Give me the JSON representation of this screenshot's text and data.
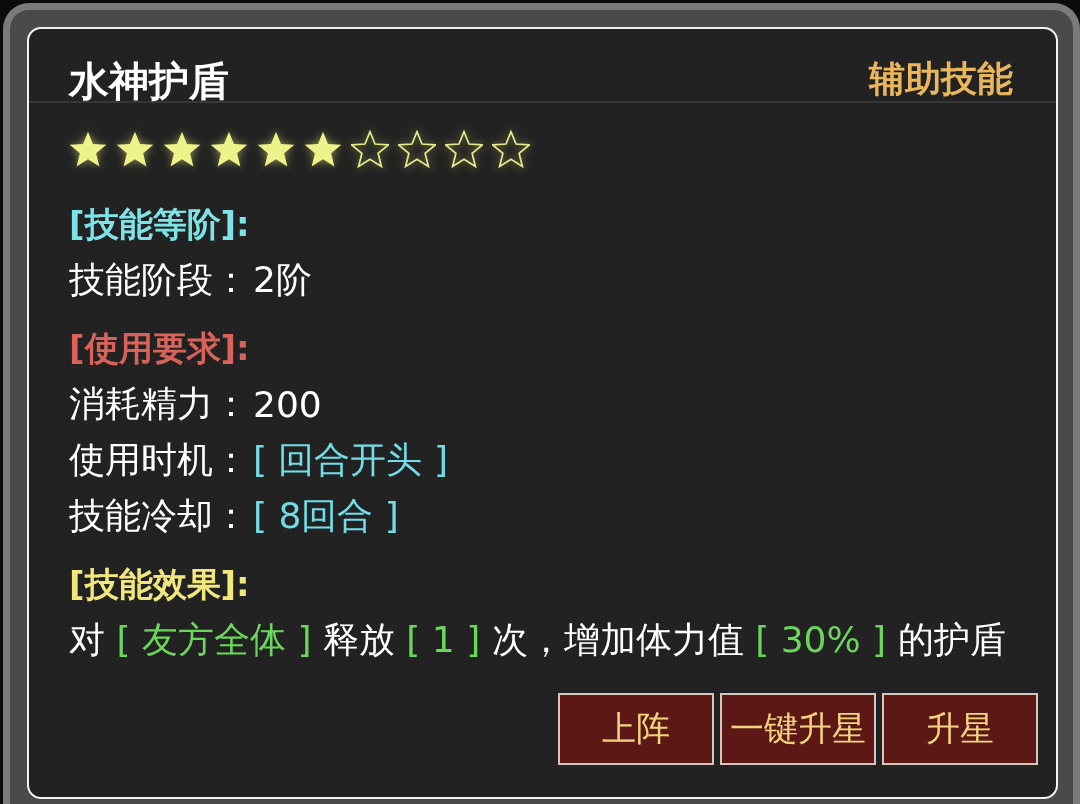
{
  "skill": {
    "name": "水神护盾",
    "category": "辅助技能",
    "stars": 6
  },
  "sections": [
    {
      "heading": "[技能等阶]:",
      "color": "#7ee3e6",
      "rows": [
        {
          "kind": "pair",
          "label": "技能阶段：",
          "value": "2阶",
          "color": "#ffffff"
        }
      ]
    },
    {
      "heading": "[使用要求]:",
      "color": "#d9635b",
      "rows": [
        {
          "kind": "pair",
          "label": "消耗精力：",
          "value": "200",
          "color": "#ffffff"
        },
        {
          "kind": "pair",
          "label": "使用时机：",
          "value": "[ 回合开头 ]",
          "color": "#72dde6"
        },
        {
          "kind": "pair",
          "label": "技能冷却：",
          "value": "[ 8回合 ]",
          "color": "#72dde6"
        }
      ]
    },
    {
      "heading": "[技能效果]:",
      "color": "#f2e77d",
      "rows": [
        {
          "kind": "sentence",
          "segments": [
            {
              "text": "对",
              "color": "#ffffff"
            },
            {
              "text": "[ 友方全体 ]",
              "color": "#6cd55c"
            },
            {
              "text": "释放",
              "color": "#ffffff"
            },
            {
              "text": "[ 1 ]",
              "color": "#6cd55c"
            },
            {
              "text": "次，增加体力值",
              "color": "#ffffff"
            },
            {
              "text": "[ 30% ]",
              "color": "#6cd55c"
            },
            {
              "text": "的护盾",
              "color": "#ffffff"
            }
          ]
        }
      ]
    }
  ],
  "buttons": [
    {
      "label": "上阵"
    },
    {
      "label": "一键升星"
    },
    {
      "label": "升星"
    }
  ]
}
